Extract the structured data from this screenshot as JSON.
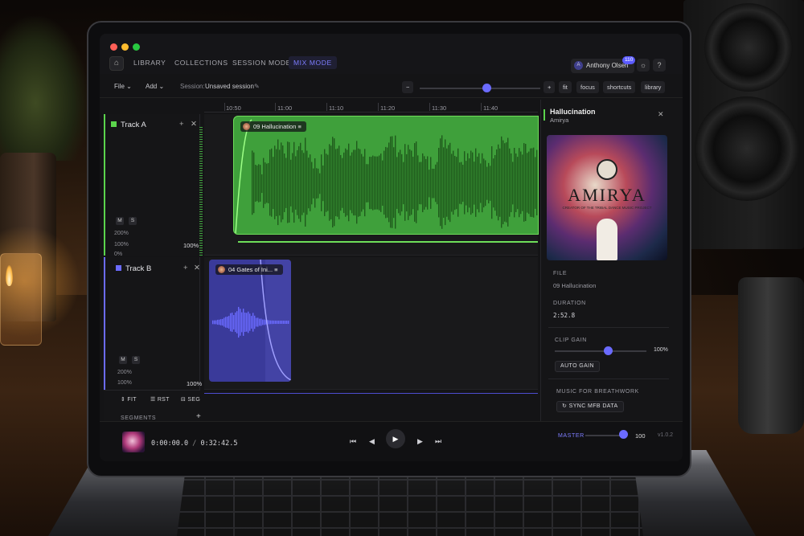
{
  "nav": {
    "home_icon": "home-icon",
    "items": [
      {
        "label": "LIBRARY",
        "active": false
      },
      {
        "label": "COLLECTIONS",
        "active": false
      },
      {
        "label": "SESSION MODE",
        "active": false
      },
      {
        "label": "MIX MODE",
        "active": true
      }
    ],
    "user_initial": "A",
    "user_name": "Anthony Olsen",
    "user_badge": "110",
    "theme_icon": "sun-icon",
    "help_label": "?"
  },
  "toolbar": {
    "file_label": "File",
    "add_label": "Add",
    "session_prefix": "Session:",
    "session_name": "Unsaved session",
    "zoom_out": "−",
    "zoom_in": "+",
    "buttons": [
      "fit",
      "focus",
      "shortcuts",
      "library"
    ]
  },
  "timeline": {
    "ticks": [
      "10:50",
      "11:00",
      "11:10",
      "11:20",
      "11:30",
      "11:40"
    ]
  },
  "tracks": [
    {
      "name": "Track A",
      "color": "#5bd44c",
      "mute": "M",
      "solo": "S",
      "scale_top": "200%",
      "scale_mid": "100%",
      "scale_bottom": "0%",
      "volume": "100%",
      "clip_label": "09 Hallucination"
    },
    {
      "name": "Track B",
      "color": "#6b6bff",
      "mute": "M",
      "solo": "S",
      "scale_top": "200%",
      "scale_mid": "100%",
      "volume": "100%",
      "clip_label": "04 Gates of Ini..."
    }
  ],
  "footer_buttons": {
    "fit": "FIT",
    "rst": "RST",
    "seg": "SEG"
  },
  "segments": {
    "label": "SEGMENTS",
    "add": "+"
  },
  "inspector": {
    "title": "Hallucination",
    "artist": "Amirya",
    "cover_title": "AMIRYA",
    "cover_subtitle": "CREATOR OF THE TRIBAL DANCE MUSIC PROJECT",
    "file_label": "FILE",
    "file_value": "09 Hallucination",
    "duration_label": "DURATION",
    "duration_value": "2:52.8",
    "clip_gain_label": "CLIP GAIN",
    "clip_gain_value": "100%",
    "auto_gain_label": "AUTO GAIN",
    "mfb_label": "MUSIC FOR BREATHWORK",
    "sync_label": "SYNC MFB DATA"
  },
  "transport": {
    "current_time": "0:00:00.0",
    "separator": "/",
    "total_time": "0:32:42.5",
    "master_label": "MASTER",
    "master_value": "100",
    "version": "v1.0.2"
  }
}
